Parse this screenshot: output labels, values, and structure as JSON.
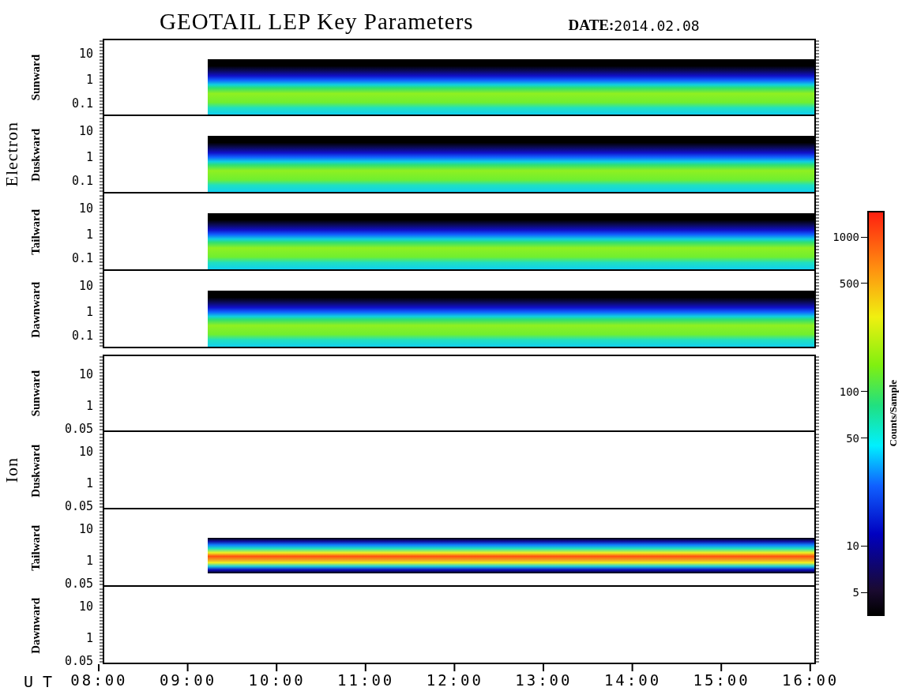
{
  "title": "GEOTAIL LEP Key Parameters",
  "date_label": "DATE:",
  "date": "2014.02.08",
  "groups": [
    {
      "name": "Electron",
      "kind": "electron",
      "panels": [
        {
          "direction": "Sunward",
          "yticks": [
            "10",
            "1",
            "0.1"
          ],
          "kind": "electron"
        },
        {
          "direction": "Duskward",
          "yticks": [
            "10",
            "1",
            "0.1"
          ],
          "kind": "electron"
        },
        {
          "direction": "Tailward",
          "yticks": [
            "10",
            "1",
            "0.1"
          ],
          "kind": "electron"
        },
        {
          "direction": "Dawnward",
          "yticks": [
            "10",
            "1",
            "0.1"
          ],
          "kind": "electron"
        }
      ]
    },
    {
      "name": "Ion",
      "kind": "ion",
      "panels": [
        {
          "direction": "Sunward",
          "yticks": [
            "10",
            "1",
            "0.05"
          ],
          "kind": "empty"
        },
        {
          "direction": "Duskward",
          "yticks": [
            "10",
            "1",
            "0.05"
          ],
          "kind": "empty"
        },
        {
          "direction": "Tailward",
          "yticks": [
            "10",
            "1",
            "0.05"
          ],
          "kind": "band"
        },
        {
          "direction": "Dawnward",
          "yticks": [
            "10",
            "1",
            "0.05"
          ],
          "kind": "empty"
        }
      ]
    }
  ],
  "time_axis": {
    "label": "U T",
    "ticks": [
      "08:00",
      "09:00",
      "10:00",
      "11:00",
      "12:00",
      "13:00",
      "14:00",
      "15:00",
      "16:00"
    ]
  },
  "colorbar": {
    "label": "Counts/Sample",
    "ticks": [
      "1000",
      "500",
      "100",
      "50",
      "10",
      "5"
    ]
  }
}
